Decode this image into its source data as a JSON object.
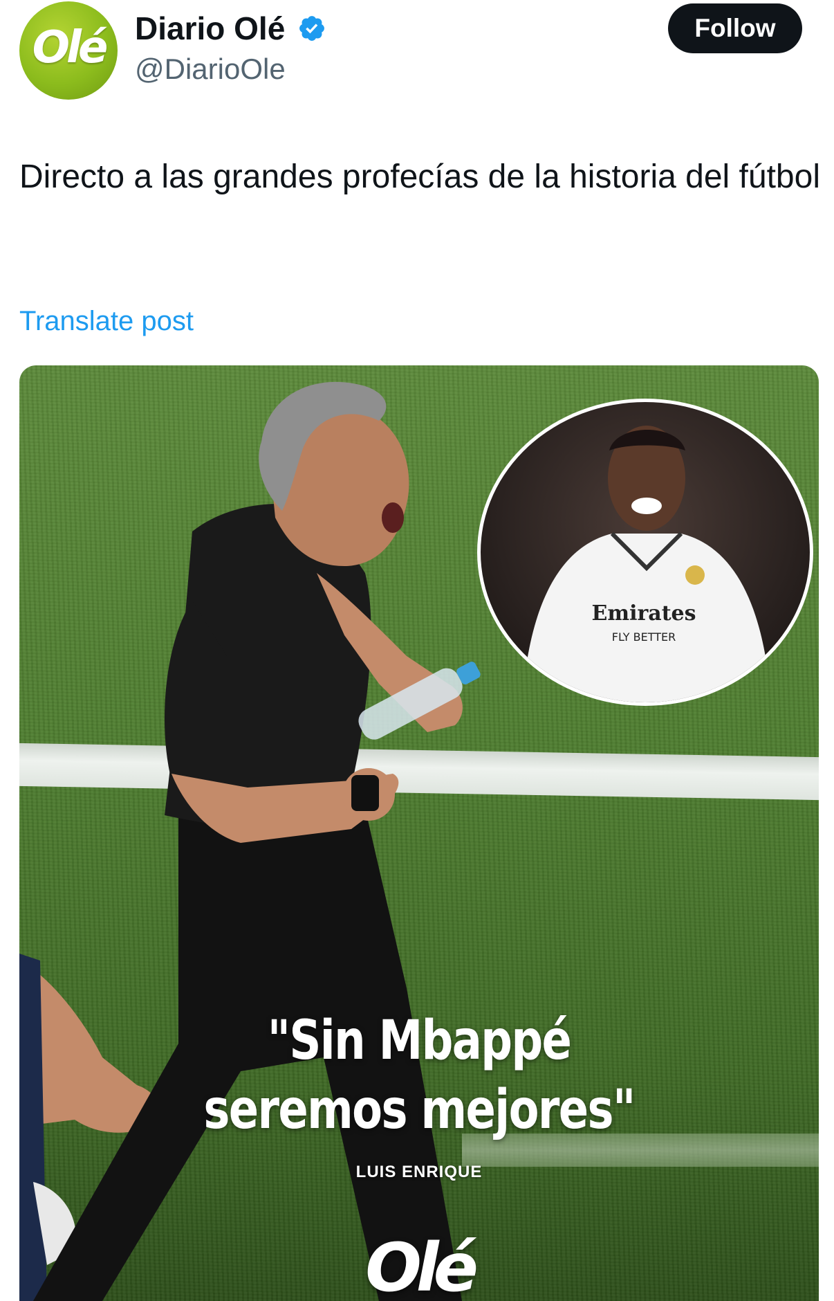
{
  "account": {
    "display_name": "Diario Olé",
    "handle": "@DiarioOle",
    "avatar_text": "Olé",
    "verified": true
  },
  "follow_label": "Follow",
  "post": {
    "text": "Directo a las grandes profecías de la historia del fútbol",
    "translate_label": "Translate post"
  },
  "media": {
    "quote_line1": "\"Sin Mbappé",
    "quote_line2": "seremos mejores\"",
    "author": "LUIS ENRIQUE",
    "logo": "Olé",
    "inset_sponsor": "Emirates",
    "inset_sponsor_sub": "FLY BETTER"
  },
  "colors": {
    "link": "#1d9bf0",
    "text": "#0f1419",
    "secondary": "#536471",
    "verified": "#1d9bf0",
    "brand_green": "#8cbc1d"
  },
  "icons": [
    "verified-badge-icon"
  ]
}
